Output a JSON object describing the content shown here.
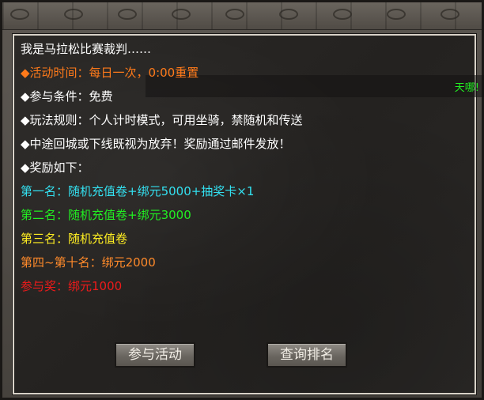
{
  "dialog": {
    "intro": "我是马拉松比赛裁判……",
    "lines": [
      {
        "text": "◆活动时间：每日一次，0:00重置",
        "color": "#ff7a1a"
      },
      {
        "text": "◆参与条件：免费",
        "color": "#ffffff"
      },
      {
        "text": "◆玩法规则：个人计时模式，可用坐骑，禁随机和传送",
        "color": "#ffffff"
      },
      {
        "text": "◆中途回城或下线既视为放弃！奖励通过邮件发放！",
        "color": "#ffffff"
      },
      {
        "text": "◆奖励如下：",
        "color": "#ffffff"
      }
    ],
    "rewards": [
      {
        "text": "第一名：随机充值卷+绑元5000+抽奖卡×1",
        "color": "#33e0f0"
      },
      {
        "text": "第二名：随机充值卷+绑元3000",
        "color": "#22ee22"
      },
      {
        "text": "第三名：随机充值卷",
        "color": "#ffee22"
      },
      {
        "text": "第四~第十名：绑元2000",
        "color": "#ff8a2a"
      },
      {
        "text": "参与奖：绑元1000",
        "color": "#ee1a1a"
      }
    ]
  },
  "chat_bubble": "天哪!",
  "buttons": {
    "join": "参与活动",
    "ranking": "查询排名"
  }
}
